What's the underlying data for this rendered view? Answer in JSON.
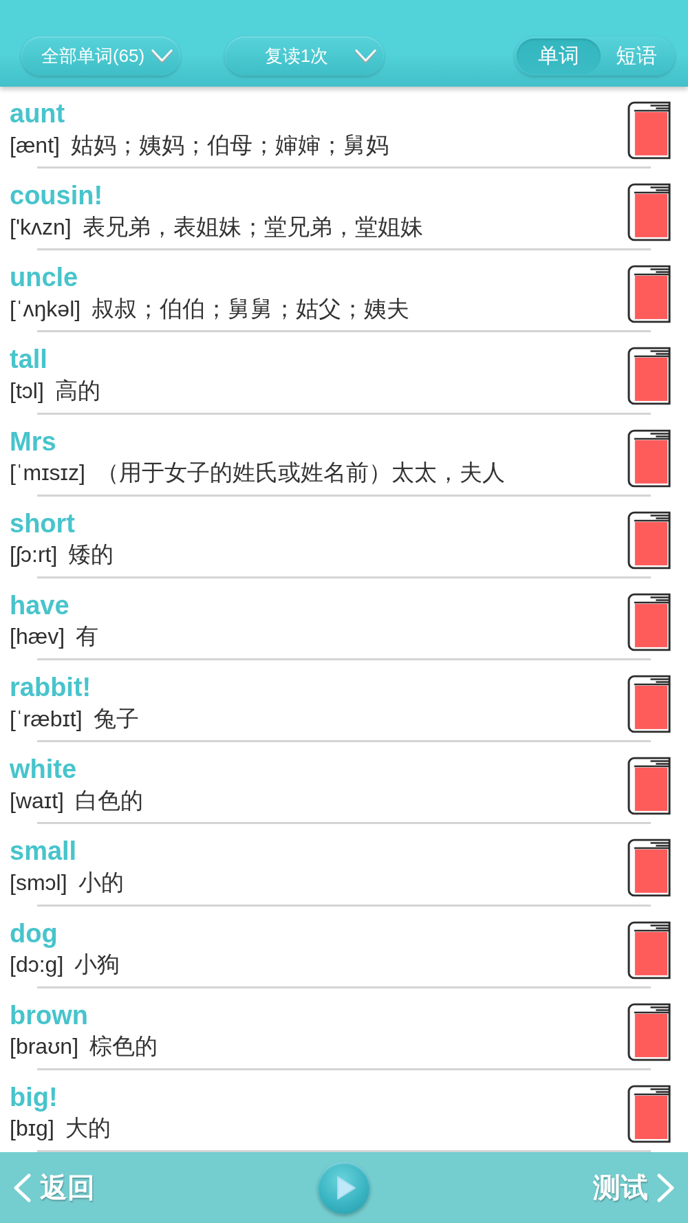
{
  "header": {
    "filter_dropdown": {
      "label": "全部单词(65)"
    },
    "repeat_dropdown": {
      "label": "复读1次"
    },
    "mode_tabs": [
      {
        "label": "单词",
        "selected": true
      },
      {
        "label": "短语",
        "selected": false
      }
    ]
  },
  "word_list": [
    {
      "word": "aunt",
      "phonetic": "[ænt]",
      "meaning": "姑妈；姨妈；伯母；婶婶；舅妈"
    },
    {
      "word": "cousin!",
      "phonetic": "['kʌzn]",
      "meaning": "表兄弟，表姐妹；堂兄弟，堂姐妹"
    },
    {
      "word": "uncle",
      "phonetic": "[ˈʌŋkəl]",
      "meaning": "叔叔；伯伯；舅舅；姑父；姨夫"
    },
    {
      "word": "tall",
      "phonetic": "[tɔl]",
      "meaning": "高的"
    },
    {
      "word": "Mrs",
      "phonetic": "[ˈmɪsɪz]",
      "meaning": "（用于女子的姓氏或姓名前）太太，夫人"
    },
    {
      "word": "short",
      "phonetic": "[ʃɔ:rt]",
      "meaning": "矮的"
    },
    {
      "word": "have",
      "phonetic": "[hæv]",
      "meaning": "有"
    },
    {
      "word": "rabbit!",
      "phonetic": "[ˈræbɪt]",
      "meaning": "兔子"
    },
    {
      "word": "white",
      "phonetic": "[waɪt]",
      "meaning": "白色的"
    },
    {
      "word": "small",
      "phonetic": "[smɔl]",
      "meaning": "小的"
    },
    {
      "word": "dog",
      "phonetic": "[dɔ:g]",
      "meaning": "小狗"
    },
    {
      "word": "brown",
      "phonetic": "[braʊn]",
      "meaning": "棕色的"
    },
    {
      "word": "big!",
      "phonetic": "[bɪg]",
      "meaning": "大的"
    }
  ],
  "bottom_bar": {
    "back_button": {
      "label": "返回"
    },
    "test_button": {
      "label": "测试"
    }
  }
}
